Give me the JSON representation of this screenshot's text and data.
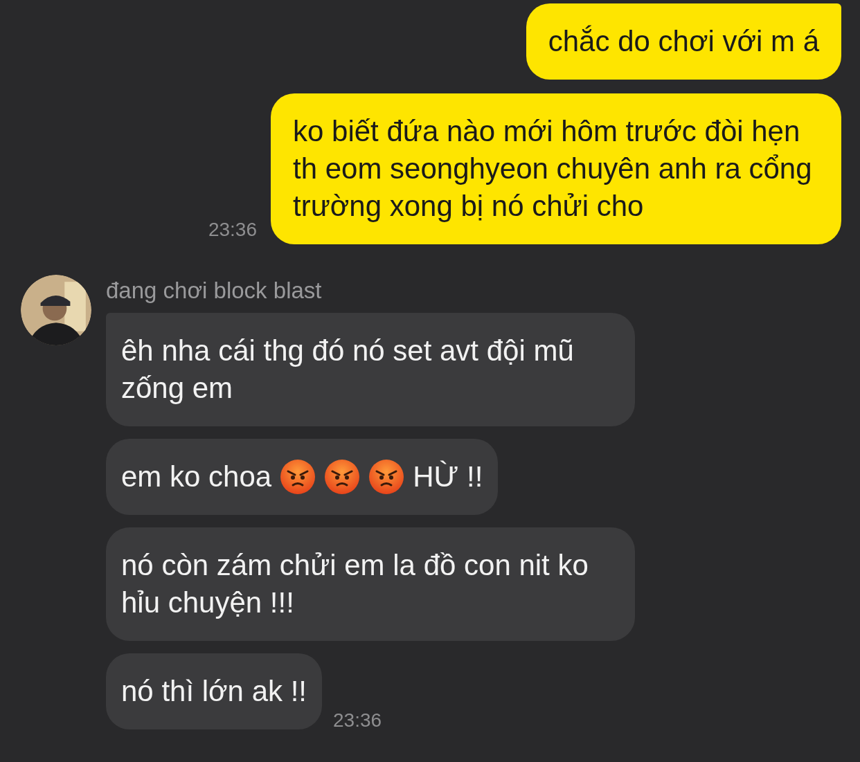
{
  "outgoing": {
    "messages": [
      {
        "text": "chắc do chơi với m á",
        "tail": true
      },
      {
        "text": "ko biết đứa nào mới hôm trước đòi hẹn th eom seonghyeon chuyên anh ra cổng trường xong bị nó chửi cho",
        "tail": false
      }
    ],
    "time": "23:36"
  },
  "incoming": {
    "status": "đang chơi block blast",
    "messages": [
      {
        "tail": true,
        "parts": [
          {
            "kind": "text",
            "text": "êh nha cái thg đó nó set avt đội mũ zống em"
          }
        ]
      },
      {
        "tail": false,
        "parts": [
          {
            "kind": "text",
            "text": "em ko choa"
          },
          {
            "kind": "angry-emoji"
          },
          {
            "kind": "angry-emoji"
          },
          {
            "kind": "angry-emoji"
          },
          {
            "kind": "text",
            "text": "HỪ !!"
          }
        ]
      },
      {
        "tail": false,
        "parts": [
          {
            "kind": "text",
            "text": "nó còn zám chửi em la đồ con nit ko hỉu chuyện !!!"
          }
        ]
      },
      {
        "tail": false,
        "parts": [
          {
            "kind": "text",
            "text": "nó thì lớn ak !!"
          }
        ]
      }
    ],
    "time": "23:36"
  }
}
